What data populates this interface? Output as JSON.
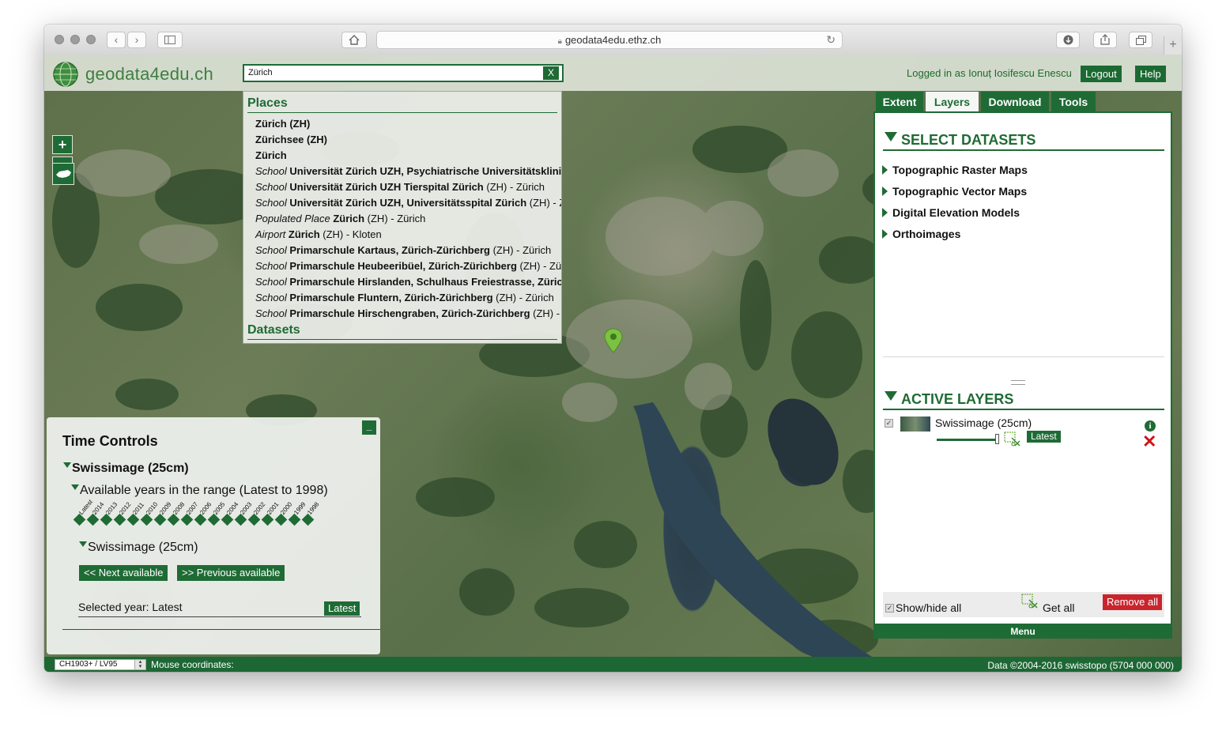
{
  "browser": {
    "url": "geodata4edu.ethz.ch"
  },
  "header": {
    "logo_text": "geodata4edu.ch",
    "search_value": "Zürich",
    "clear_label": "X",
    "login_text": "Logged in as Ionuț Iosifescu Enescu",
    "logout_label": "Logout",
    "help_label": "Help"
  },
  "search_results": {
    "places_heading": "Places",
    "datasets_heading": "Datasets",
    "items": [
      {
        "category": "",
        "name": "Zürich (ZH)",
        "rest": ""
      },
      {
        "category": "",
        "name": "Zürichsee (ZH)",
        "rest": ""
      },
      {
        "category": "",
        "name": "Zürich",
        "rest": ""
      },
      {
        "category": "School",
        "name": "Universität Zürich UZH, Psychiatrische Universitätsklini",
        "rest": ""
      },
      {
        "category": "School",
        "name": "Universität Zürich UZH Tierspital Zürich",
        "rest": " (ZH) - Zürich"
      },
      {
        "category": "School",
        "name": "Universität Zürich UZH, Universitätsspital Zürich",
        "rest": " (ZH) - Z"
      },
      {
        "category": "Populated Place",
        "name": "Zürich",
        "rest": " (ZH) - Zürich"
      },
      {
        "category": "Airport",
        "name": "Zürich",
        "rest": " (ZH) - Kloten"
      },
      {
        "category": "School",
        "name": "Primarschule Kartaus, Zürich-Zürichberg",
        "rest": " (ZH) - Zürich"
      },
      {
        "category": "School",
        "name": "Primarschule Heubeeribüel, Zürich-Zürichberg",
        "rest": " (ZH) - Zü"
      },
      {
        "category": "School",
        "name": "Primarschule Hirslanden, Schulhaus Freiestrasse, Züric",
        "rest": ""
      },
      {
        "category": "School",
        "name": "Primarschule Fluntern, Zürich-Zürichberg",
        "rest": " (ZH) - Zürich"
      },
      {
        "category": "School",
        "name": "Primarschule Hirschengraben, Zürich-Zürichberg",
        "rest": " (ZH) -"
      }
    ]
  },
  "map_controls": {
    "zoom_in": "+",
    "zoom_out": "−"
  },
  "tabs": [
    "Extent",
    "Layers",
    "Download",
    "Tools"
  ],
  "active_tab": "Layers",
  "panel": {
    "select_heading": "SELECT DATASETS",
    "datasets": [
      "Topographic Raster Maps",
      "Topographic Vector Maps",
      "Digital Elevation Models",
      "Orthoimages"
    ],
    "active_heading": "ACTIVE LAYERS",
    "layer_name": "Swissimage (25cm)",
    "layer_badge": "Latest",
    "show_hide_all": "Show/hide all",
    "get_all": "Get all",
    "remove_all": "Remove all",
    "menu_label": "Menu"
  },
  "time_controls": {
    "title": "Time Controls",
    "minimize": "_",
    "dataset": "Swissimage (25cm)",
    "range_text": "Available years in the range (Latest to 1998)",
    "years": [
      "Latest",
      "2014",
      "2013",
      "2012",
      "2011",
      "2010",
      "2009",
      "2008",
      "2007",
      "2006",
      "2005",
      "2004",
      "2003",
      "2002",
      "2001",
      "2000",
      "1999",
      "1998"
    ],
    "sub_dataset": "Swissimage (25cm)",
    "next_label": "<< Next available",
    "prev_label": ">> Previous available",
    "selected_label": "Selected year: Latest",
    "selected_badge": "Latest"
  },
  "status": {
    "crs": "CH1903+ / LV95",
    "mouse_label": "Mouse coordinates:",
    "copyright": "Data ©2004-2016 swisstopo (5704 000 000)"
  },
  "colors": {
    "brand_green": "#1f6b35",
    "remove_red": "#c9252d",
    "marker_green": "#7cc242"
  }
}
